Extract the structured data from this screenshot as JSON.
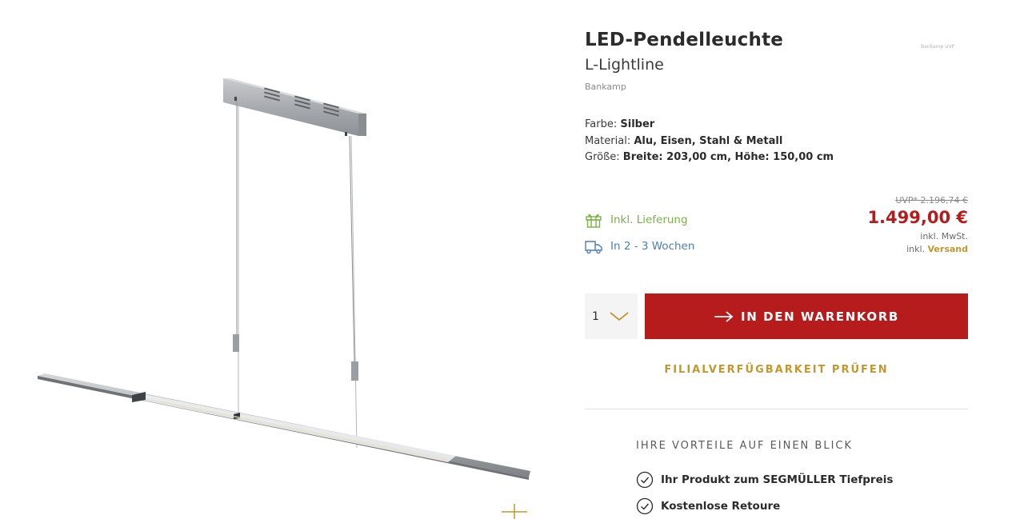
{
  "product": {
    "title": "LED-Pendelleuchte",
    "subtitle": "L-Lightline",
    "brand": "Bankamp",
    "badge_text": "Bankamp UVP"
  },
  "attributes": [
    {
      "label": "Farbe",
      "value": "Silber"
    },
    {
      "label": "Material",
      "value": "Alu, Eisen, Stahl & Metall"
    },
    {
      "label": "Größe",
      "value": "Breite: 203,00 cm, Höhe: 150,00 cm"
    }
  ],
  "delivery": {
    "included_label": "Inkl. Lieferung",
    "time_label": "In 2 - 3 Wochen"
  },
  "pricing": {
    "uvp": "UVP* 2.196,74 €",
    "price": "1.499,00 €",
    "tax_note": "inkl. MwSt.",
    "shipping_prefix": "inkl.",
    "shipping_link": "Versand"
  },
  "cart": {
    "quantity": "1",
    "button_label": "IN DEN WARENKORB"
  },
  "store_check_label": "FILIALVERFÜGBARKEIT PRÜFEN",
  "benefits": {
    "title": "IHRE VORTEILE AUF EINEN BLICK",
    "items": [
      "Ihr Produkt zum SEGMÜLLER Tiefpreis",
      "Kostenlose Retoure"
    ]
  },
  "colors": {
    "accent_red": "#b71c1c",
    "gold": "#c2982e",
    "green": "#78b244",
    "blue": "#4a7fb5"
  },
  "icons": {
    "gift": "gift-icon",
    "truck": "truck-icon",
    "arrow": "arrow-right-icon",
    "chevron": "chevron-down-icon",
    "check": "check-circle-icon",
    "zoom": "zoom-plus-icon"
  }
}
